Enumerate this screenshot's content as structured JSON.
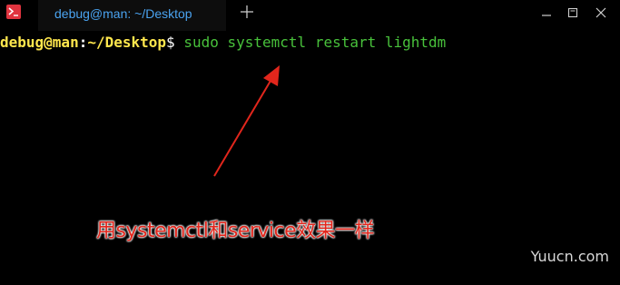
{
  "window": {
    "tab_title": "debug@man: ~/Desktop",
    "new_tab_symbol": "+"
  },
  "terminal": {
    "prompt_user_host": "debug@man",
    "prompt_colon": ":",
    "prompt_path": "~/Desktop",
    "prompt_symbol": "$",
    "command": " sudo systemctl restart lightdm"
  },
  "annotation": {
    "caption": "用systemctl和service效果一样",
    "color": "#e1261c"
  },
  "watermark": {
    "text": "Yuucn.com"
  },
  "colors": {
    "tab_text": "#4aa3f0",
    "prompt": "#ffe74d",
    "command": "#48c13b",
    "background": "#000000"
  },
  "icons": [
    "terminal-app-icon",
    "plus-icon",
    "minimize-icon",
    "maximize-icon",
    "close-icon",
    "arrow-annotation"
  ]
}
